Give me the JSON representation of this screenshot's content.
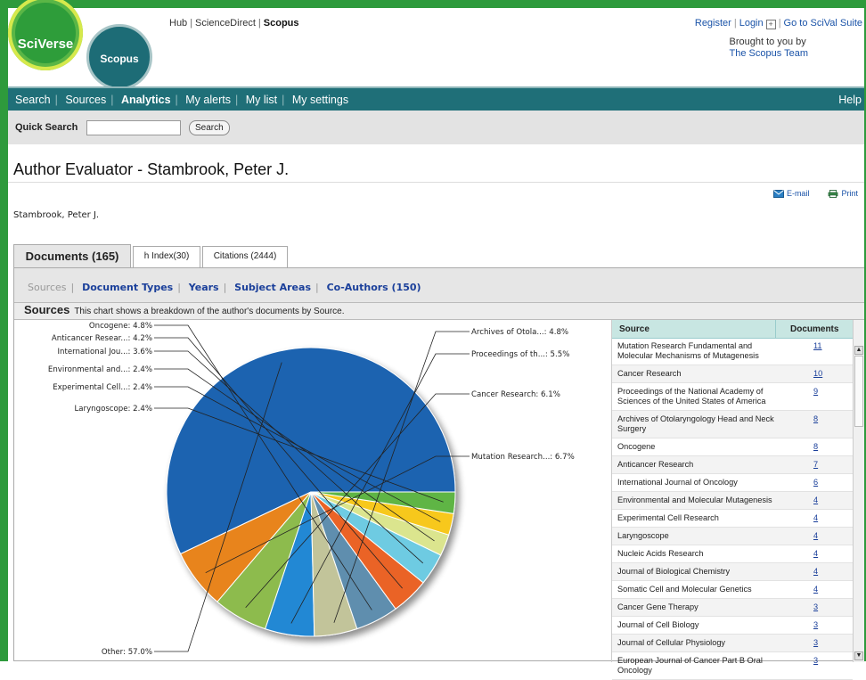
{
  "header": {
    "sciverse_logo": "SciVerse",
    "scopus_logo": "Scopus",
    "hub_links": [
      "Hub",
      "ScienceDirect",
      "Scopus"
    ],
    "register": "Register",
    "login": "Login",
    "login_icon": "plus-box-icon",
    "scival": "Go to SciVal Suite",
    "brought_by": "Brought to you by",
    "team": "The Scopus Team"
  },
  "nav": {
    "items": [
      "Search",
      "Sources",
      "Analytics",
      "My alerts",
      "My list",
      "My settings"
    ],
    "active": "Analytics",
    "help": "Help"
  },
  "quick_search": {
    "label": "Quick Search",
    "value": "",
    "button": "Search"
  },
  "page": {
    "title": "Author Evaluator - Stambrook, Peter J.",
    "email": "E-mail",
    "print": "Print",
    "author_name": "Stambrook, Peter J."
  },
  "tabs": [
    {
      "label": "Documents (165)",
      "active": true
    },
    {
      "label": "h Index(30)",
      "active": false
    },
    {
      "label": "Citations (2444)",
      "active": false
    }
  ],
  "subnav": {
    "current": "Sources",
    "links": [
      "Document Types",
      "Years",
      "Subject Areas",
      "Co-Authors (150)"
    ]
  },
  "section": {
    "title": "Sources",
    "description": "This chart shows a breakdown of the author's documents by Source."
  },
  "chart_data": {
    "type": "pie",
    "slices": [
      {
        "label": "Other: 57.0%",
        "value": 57.0,
        "color": "#1f63b0"
      },
      {
        "label": "Mutation Research...: 6.7%",
        "value": 6.7,
        "color": "#e8841e"
      },
      {
        "label": "Cancer Research: 6.1%",
        "value": 6.1,
        "color": "#8dbb4e"
      },
      {
        "label": "Proceedings of th...: 5.5%",
        "value": 5.5,
        "color": "#2488d4"
      },
      {
        "label": "Archives of Otola...: 4.8%",
        "value": 4.8,
        "color": "#c2c49a"
      },
      {
        "label": "Oncogene: 4.8%",
        "value": 4.8,
        "color": "#5f8eae"
      },
      {
        "label": "Anticancer Resear...: 4.2%",
        "value": 4.2,
        "color": "#ea6428"
      },
      {
        "label": "International Jou...: 3.6%",
        "value": 3.6,
        "color": "#6ecbe2"
      },
      {
        "label": "Environmental and...: 2.4%",
        "value": 2.4,
        "color": "#dbe58e"
      },
      {
        "label": "Experimental Cell...: 2.4%",
        "value": 2.4,
        "color": "#f7c81e"
      },
      {
        "label": "Laryngoscope: 2.4%",
        "value": 2.4,
        "color": "#5fb544"
      }
    ]
  },
  "source_table": {
    "col_source": "Source",
    "col_documents": "Documents",
    "rows": [
      {
        "source": "Mutation Research Fundamental and Molecular Mechanisms of Mutagenesis",
        "count": "11"
      },
      {
        "source": "Cancer Research",
        "count": "10"
      },
      {
        "source": "Proceedings of the National Academy of Sciences of the United States of America",
        "count": "9"
      },
      {
        "source": "Archives of Otolaryngology Head and Neck Surgery",
        "count": "8"
      },
      {
        "source": "Oncogene",
        "count": "8"
      },
      {
        "source": "Anticancer Research",
        "count": "7"
      },
      {
        "source": "International Journal of Oncology",
        "count": "6"
      },
      {
        "source": "Environmental and Molecular Mutagenesis",
        "count": "4"
      },
      {
        "source": "Experimental Cell Research",
        "count": "4"
      },
      {
        "source": "Laryngoscope",
        "count": "4"
      },
      {
        "source": "Nucleic Acids Research",
        "count": "4"
      },
      {
        "source": "Journal of Biological Chemistry",
        "count": "4"
      },
      {
        "source": "Somatic Cell and Molecular Genetics",
        "count": "4"
      },
      {
        "source": "Cancer Gene Therapy",
        "count": "3"
      },
      {
        "source": "Journal of Cell Biology",
        "count": "3"
      },
      {
        "source": "Journal of Cellular Physiology",
        "count": "3"
      },
      {
        "source": "European Journal of Cancer Part B Oral Oncology",
        "count": "3"
      }
    ]
  }
}
